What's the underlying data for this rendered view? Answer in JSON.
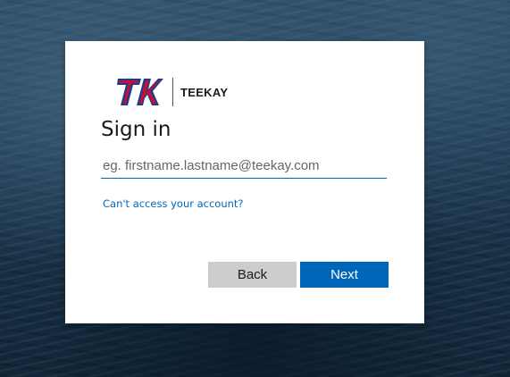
{
  "page": {
    "background_color": "#1d3850"
  },
  "brand": {
    "logo_initials": "TK",
    "name": "TEEKAY",
    "logo_colors": {
      "red": "#c8102e",
      "blue": "#1f3b8c"
    }
  },
  "signin": {
    "title": "Sign in",
    "email_placeholder": "eg. firstname.lastname@teekay.com",
    "email_value": "",
    "help_link": "Can't access your account?"
  },
  "buttons": {
    "back_label": "Back",
    "next_label": "Next"
  },
  "colors": {
    "accent": "#0067b8",
    "secondary_button": "#cccccc"
  }
}
